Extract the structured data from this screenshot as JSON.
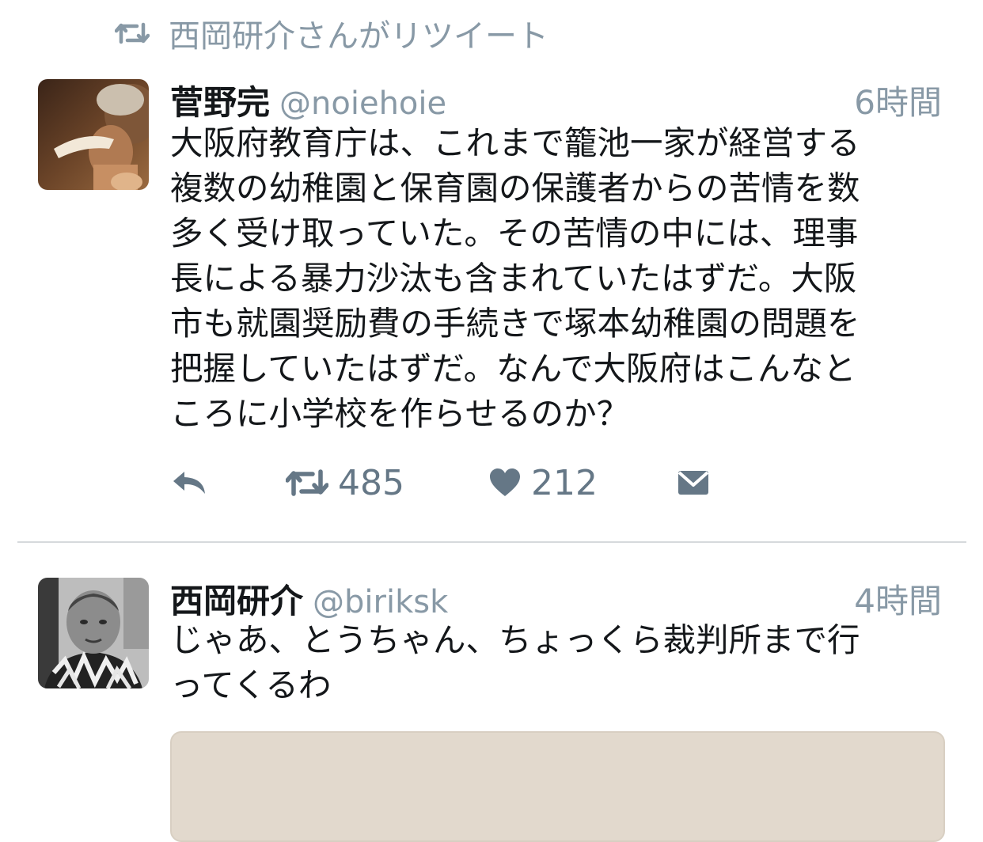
{
  "retweet_context": {
    "icon": "retweet-icon",
    "text": "西岡研介さんがリツイート"
  },
  "tweets": [
    {
      "display_name": "菅野完",
      "handle": "@noiehoie",
      "time": "6時間",
      "body_lines": [
        "大阪府教育庁は、これまで籠池一家が経営する",
        "複数の幼稚園と保育園の保護者からの苦情を数",
        "多く受け取っていた。その苦情の中には、理事",
        "長による暴力沙汰も含まれていたはずだ。大阪",
        "市も就園奨励費の手続きで塚本幼稚園の問題を",
        "把握していたはずだ。なんで大阪府はこんなと",
        "ころに小学校を作らせるのか？"
      ],
      "actions": {
        "reply_icon": "reply-icon",
        "retweet_icon": "retweet-icon",
        "retweet_count": "485",
        "like_icon": "heart-icon",
        "like_count": "212",
        "dm_icon": "envelope-icon"
      }
    },
    {
      "display_name": "西岡研介",
      "handle": "@biriksk",
      "time": "4時間",
      "body_lines": [
        "じゃあ、とうちゃん、ちょっくら裁判所まで行",
        "ってくるわ"
      ]
    }
  ],
  "colors": {
    "secondary_text": "#8899a6",
    "action_icon": "#657786",
    "divider": "#d6d9dc"
  }
}
